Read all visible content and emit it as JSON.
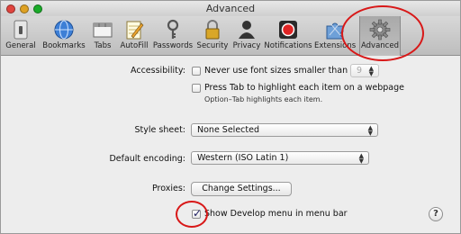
{
  "window": {
    "title": "Advanced"
  },
  "toolbar": {
    "items": [
      {
        "label": "General",
        "icon": "general-switch-icon"
      },
      {
        "label": "Bookmarks",
        "icon": "globe-icon"
      },
      {
        "label": "Tabs",
        "icon": "tabs-icon"
      },
      {
        "label": "AutoFill",
        "icon": "pencil-notepad-icon"
      },
      {
        "label": "Passwords",
        "icon": "key-icon"
      },
      {
        "label": "Security",
        "icon": "lock-icon"
      },
      {
        "label": "Privacy",
        "icon": "silhouette-icon"
      },
      {
        "label": "Notifications",
        "icon": "notification-dot-icon"
      },
      {
        "label": "Extensions",
        "icon": "puzzle-icon"
      },
      {
        "label": "Advanced",
        "icon": "gear-icon"
      }
    ],
    "selected": "Advanced"
  },
  "accessibility": {
    "label": "Accessibility:",
    "min_font_label": "Never use font sizes smaller than",
    "min_font_value": "9",
    "tab_highlight_label": "Press Tab to highlight each item on a webpage",
    "tab_hint": "Option–Tab highlights each item."
  },
  "style_sheet": {
    "label": "Style sheet:",
    "value": "None Selected"
  },
  "encoding": {
    "label": "Default encoding:",
    "value": "Western (ISO Latin 1)"
  },
  "proxies": {
    "label": "Proxies:",
    "button": "Change Settings..."
  },
  "develop": {
    "label": "Show Develop menu in menu bar",
    "checked": true
  },
  "help": {
    "label": "?"
  },
  "colors": {
    "annotation": "#d81818",
    "close": "#e0443e",
    "minimize": "#dea123",
    "zoom": "#1aab29"
  }
}
